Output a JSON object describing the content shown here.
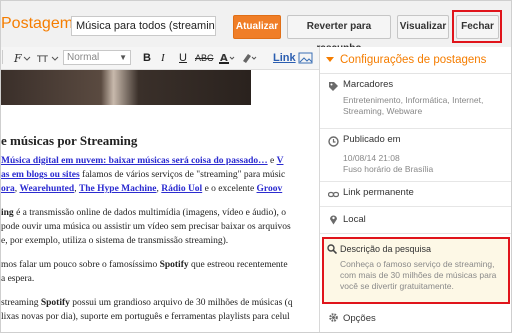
{
  "header": {
    "brand": "Postagem",
    "title_value": "Música para todos (streaming de q",
    "buttons": {
      "update": "Atualizar",
      "revert": "Reverter para rascunho",
      "view": "Visualizar",
      "close": "Fechar"
    }
  },
  "toolbar": {
    "format_select": "Normal",
    "bold": "B",
    "italic": "I",
    "underline": "U",
    "strike": "ABC",
    "link": "Link"
  },
  "editor": {
    "heading": "e músicas por Streaming",
    "lines": {
      "l1_link": "Música digital em nuvem: baixar músicas será coisa do passado…",
      "l1_text": " e ",
      "l1_link2": "V",
      "l2_link": "as em blogs ou sites",
      "l2_text": " falamos de vários serviços de \"streaming\" para músic",
      "l3_links": [
        "ora",
        "Wearehunted",
        "The Hype Machine",
        "Rádio Uol"
      ],
      "l3_text": " e o excelente ",
      "l3_link_end": "Groov",
      "l4_bold": "ing",
      "l4_text": " é a transmissão online de dados multimídia (imagens, vídeo e áudio), o",
      "l5_text": " pode ouvir uma música ou assistir um vídeo sem precisar baixar os arquivos",
      "l6_text": "e, por exemplo, utiliza o sistema de transmissão streaming).",
      "l7_text": "mos falar um pouco sobre o famosíssimo ",
      "l7_bold": "Spotify",
      "l7_text2": " que estreou recentemente",
      "l8_text": "a espera.",
      "l9_text": "streaming ",
      "l9_bold": "Spotify",
      "l9_text2": " possui um grandioso arquivo de 30 milhões de músicas (q",
      "l10_text": "lixas novas por dia), suporte em português e ferramentas playlists para celul"
    }
  },
  "panel": {
    "title": "Configurações de postagens",
    "labels": {
      "title": "Marcadores",
      "value": "Entretenimento, Informática, Internet, Streaming, Webware"
    },
    "published": {
      "title": "Publicado em",
      "date": "10/08/14 21:08",
      "timezone": "Fuso horário de Brasília"
    },
    "permalink": "Link permanente",
    "location": "Local",
    "search_description": {
      "title": "Descrição da pesquisa",
      "text": "Conheça o famoso serviço de streaming, com mais de 30 milhões de músicas para você se divertir gratuitamente."
    },
    "options": "Opções"
  },
  "colors": {
    "accent": "#f57d00",
    "highlight": "#e0141b",
    "link": "#2b2bd0"
  }
}
